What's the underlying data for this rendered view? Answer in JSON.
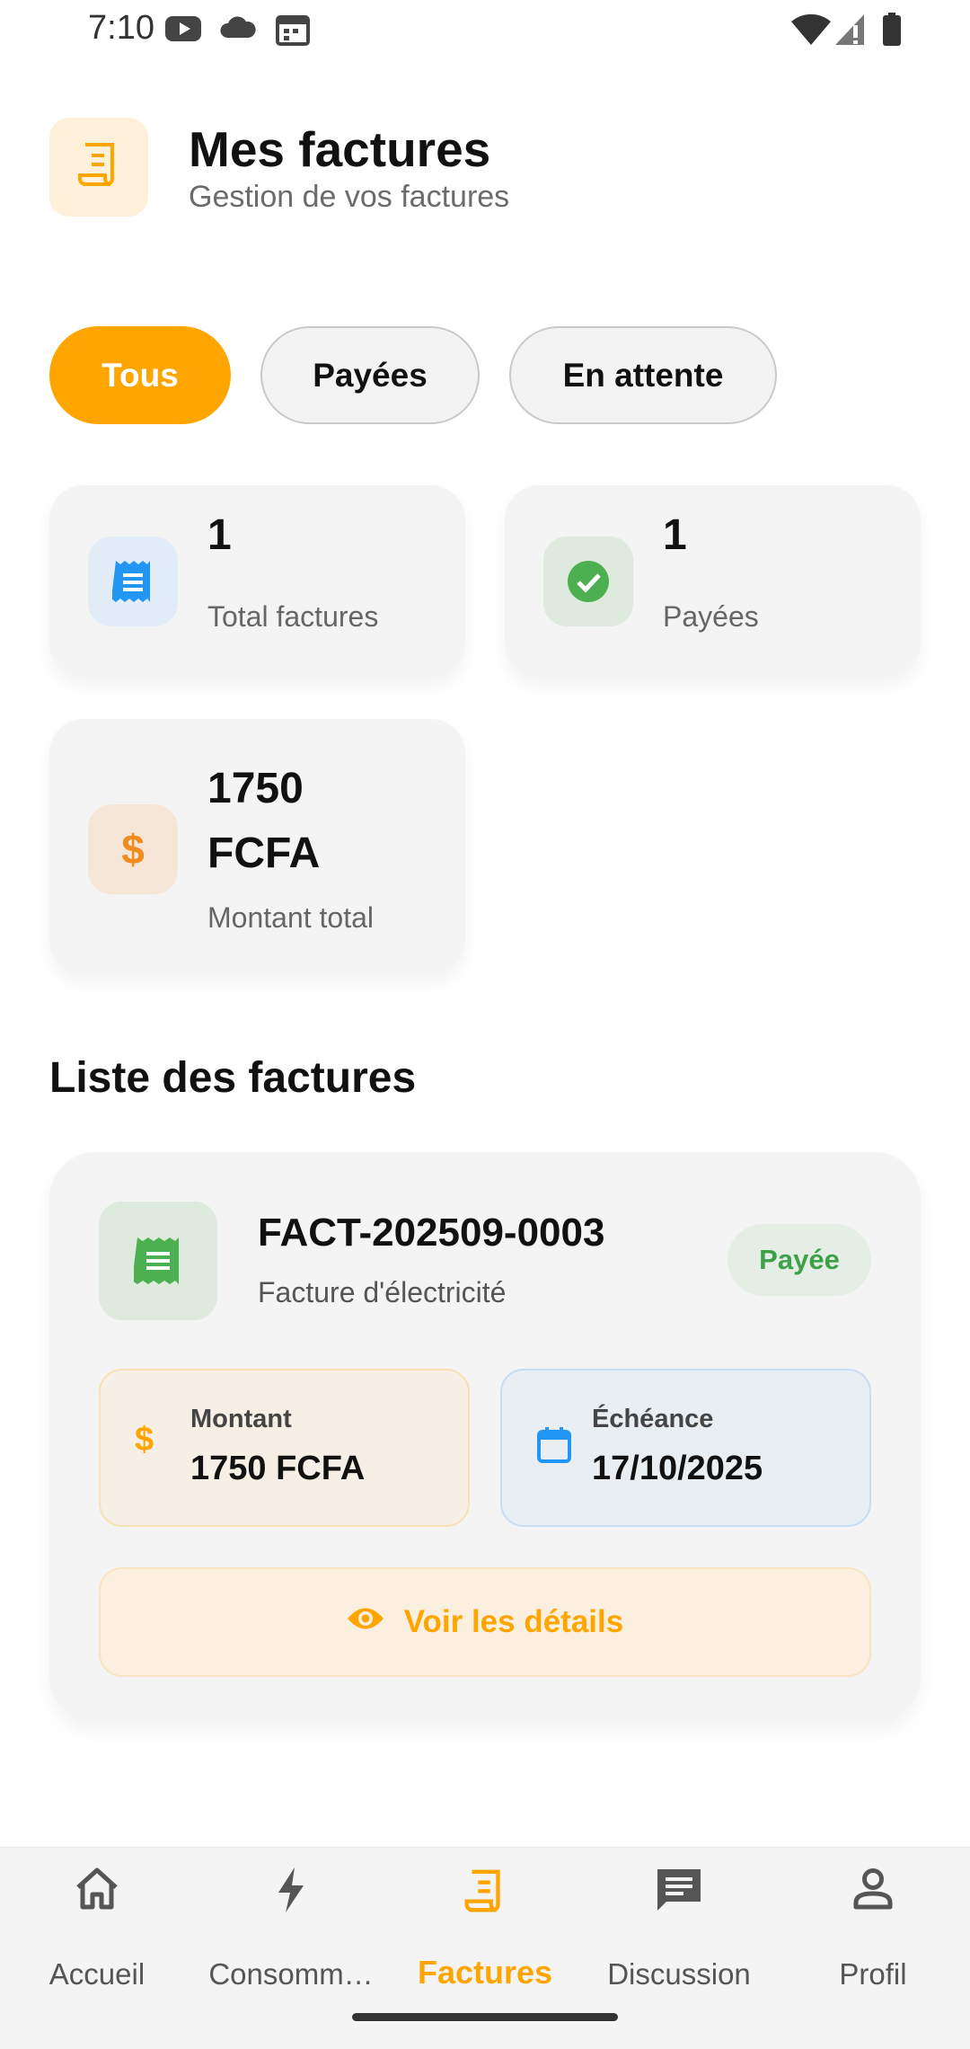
{
  "status_bar": {
    "time": "7:10"
  },
  "header": {
    "title": "Mes factures",
    "subtitle": "Gestion de vos factures"
  },
  "filters": [
    {
      "label": "Tous",
      "active": true
    },
    {
      "label": "Payées",
      "active": false
    },
    {
      "label": "En attente",
      "active": false
    }
  ],
  "stats": {
    "total": {
      "value": "1",
      "label": "Total factures"
    },
    "paid": {
      "value": "1",
      "label": "Payées"
    },
    "amount": {
      "value_line1": "1750",
      "value_line2": "FCFA",
      "label": "Montant total"
    }
  },
  "section_title": "Liste des factures",
  "invoice": {
    "number": "FACT-202509-0003",
    "type": "Facture d'électricité",
    "status": "Payée",
    "amount_label": "Montant",
    "amount_value": "1750 FCFA",
    "due_label": "Échéance",
    "due_value": "17/10/2025",
    "details_label": "Voir les détails"
  },
  "bottom_nav": [
    {
      "label": "Accueil",
      "icon": "home-icon",
      "active": false
    },
    {
      "label": "Consomm…",
      "icon": "bolt-icon",
      "active": false
    },
    {
      "label": "Factures",
      "icon": "receipt-icon",
      "active": true
    },
    {
      "label": "Discussion",
      "icon": "chat-icon",
      "active": false
    },
    {
      "label": "Profil",
      "icon": "person-icon",
      "active": false
    }
  ],
  "colors": {
    "accent": "#ffa500",
    "paid_green": "#3fa04a",
    "info_blue": "#2196f3"
  }
}
